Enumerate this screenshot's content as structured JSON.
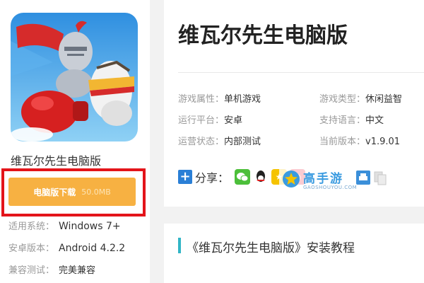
{
  "app": {
    "name": "维瓦尔先生电脑版",
    "download_label": "电脑版下载",
    "download_size": "50.0MB"
  },
  "left_meta": [
    {
      "label": "适用系统：",
      "value": "Windows 7+"
    },
    {
      "label": "安卓版本：",
      "value": "Android 4.2.2"
    },
    {
      "label": "兼容测试：",
      "value": "完美兼容"
    }
  ],
  "info": {
    "game_attr": {
      "label": "游戏属性：",
      "value": "单机游戏"
    },
    "game_type": {
      "label": "游戏类型：",
      "value": "休闲益智"
    },
    "platform": {
      "label": "运行平台：",
      "value": "安卓"
    },
    "language": {
      "label": "支持语言：",
      "value": "中文"
    },
    "status": {
      "label": "运营状态：",
      "value": "内部测试"
    },
    "version": {
      "label": "当前版本：",
      "value": "v1.9.01"
    }
  },
  "share": {
    "label": "分享：",
    "icons": [
      "plus-icon",
      "wechat-icon",
      "qq-icon",
      "qzone-icon",
      "weibo-icon",
      "print-icon",
      "copy-icon"
    ]
  },
  "watermark": {
    "text": "高手游",
    "sub": "GAOSHOUYOU.COM"
  },
  "tutorial": {
    "title": "《维瓦尔先生电脑版》安装教程"
  },
  "colors": {
    "download_button": "#f7b142",
    "highlight_frame": "#e3141a",
    "section_bar": "#31b5c6",
    "share_plus": "#2a7fd6"
  }
}
